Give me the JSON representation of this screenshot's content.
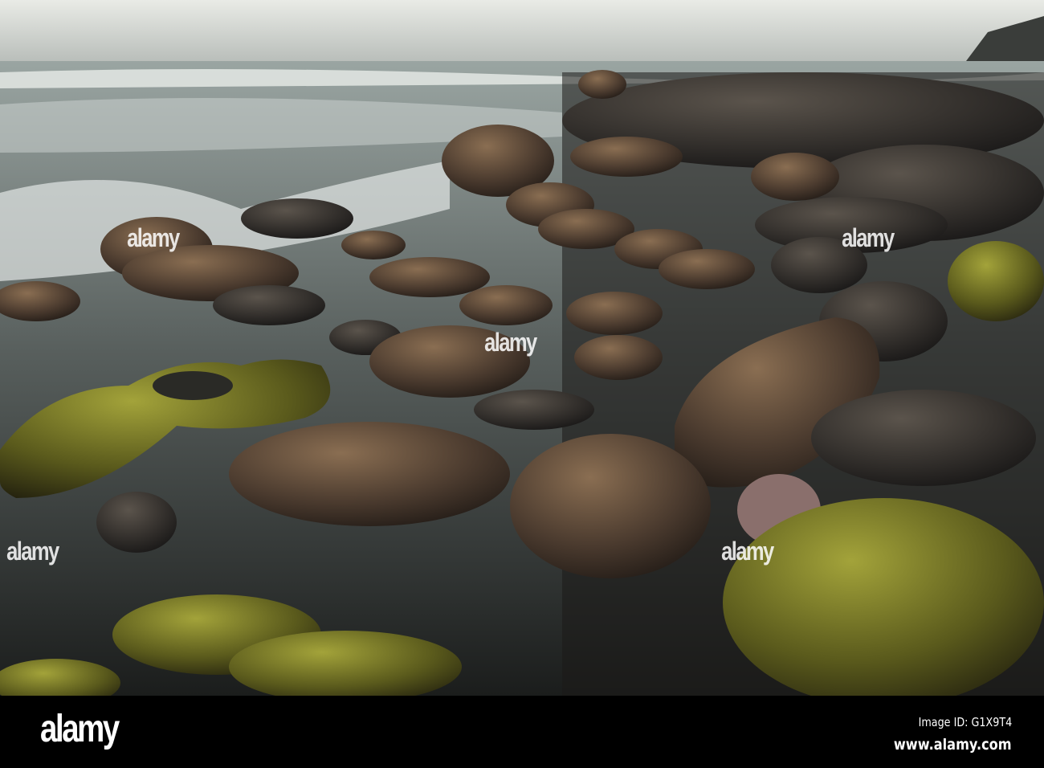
{
  "watermark": {
    "text": "alamy",
    "small_text": "a"
  },
  "footer": {
    "logo": "alamy",
    "image_id": "Image ID: G1X9T4",
    "website": "www.alamy.com"
  },
  "colors": {
    "sky": "#d9dcd6",
    "sea": "#6f7a78",
    "rock": "#4a3a2e",
    "moss": "#6b6a1e",
    "footer": "#000000"
  }
}
